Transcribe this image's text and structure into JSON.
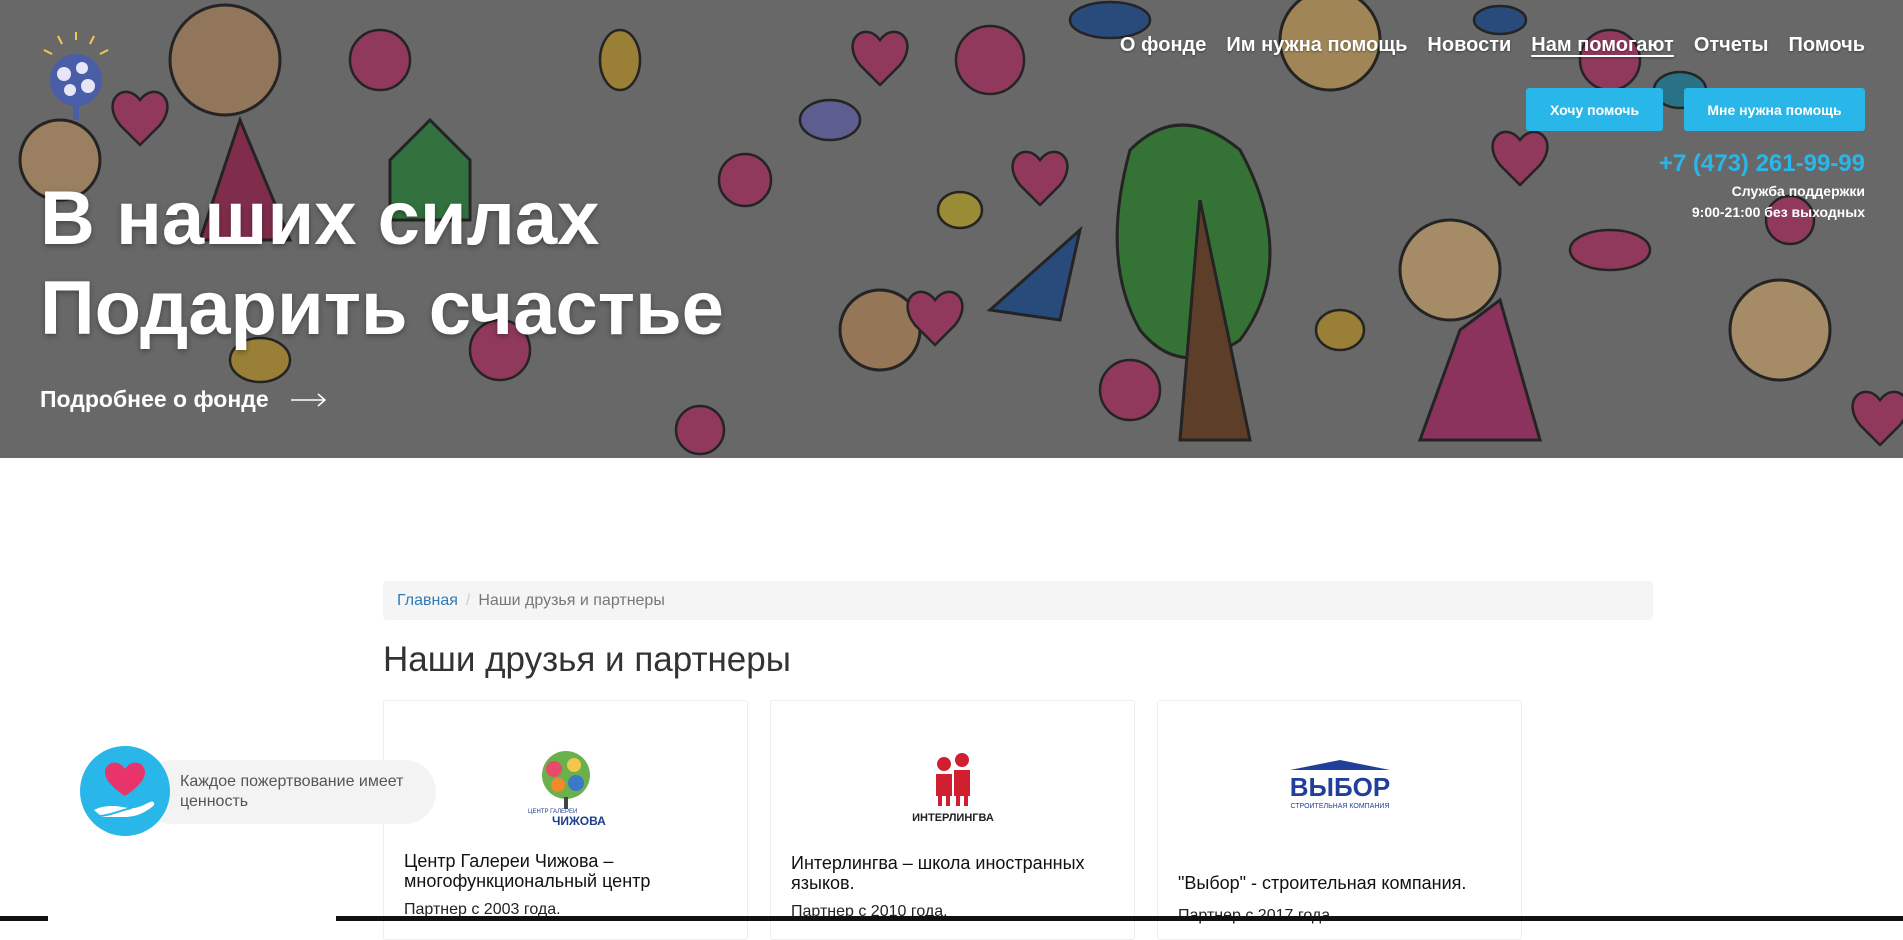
{
  "nav": {
    "items": [
      {
        "label": "О фонде"
      },
      {
        "label": "Им нужна помощь"
      },
      {
        "label": "Новости"
      },
      {
        "label": "Нам помогают",
        "active": true
      },
      {
        "label": "Отчеты"
      },
      {
        "label": "Помочь"
      }
    ]
  },
  "buttons": {
    "want_help": "Хочу помочь",
    "need_help": "Мне нужна помощь"
  },
  "contact": {
    "phone": "+7 (473) 261-99-99",
    "support_label": "Служба поддержки",
    "hours": "9:00-21:00 без выходных"
  },
  "hero": {
    "line1": "В наших силах",
    "line2": "Подарить счастье",
    "more_link": "Подробнее о фонде"
  },
  "breadcrumb": {
    "home": "Главная",
    "current": "Наши друзья и партнеры"
  },
  "page_title": "Наши друзья и партнеры",
  "partners": [
    {
      "name": "Центр Галереи Чижова – многофункциональный центр",
      "since": "Партнер с 2003 года.",
      "logo_text": "ЧИЖОВА",
      "logo_sub": "ЦЕНТР ГАЛЕРЕИ"
    },
    {
      "name": "Интерлингва – школа иностранных языков.",
      "since": "Партнер с 2010 года.",
      "logo_text": "ИНТЕРЛИНГВА"
    },
    {
      "name": "\"Выбор\" - строительная компания.",
      "since": "Партнер с 2017 года.",
      "logo_text": "ВЫБОР",
      "logo_sub": "СТРОИТЕЛЬНАЯ КОМПАНИЯ"
    }
  ],
  "donation_widget": {
    "text": "Каждое пожертвование имеет ценность"
  },
  "colors": {
    "accent": "#29b6e8",
    "link": "#337ab7"
  }
}
